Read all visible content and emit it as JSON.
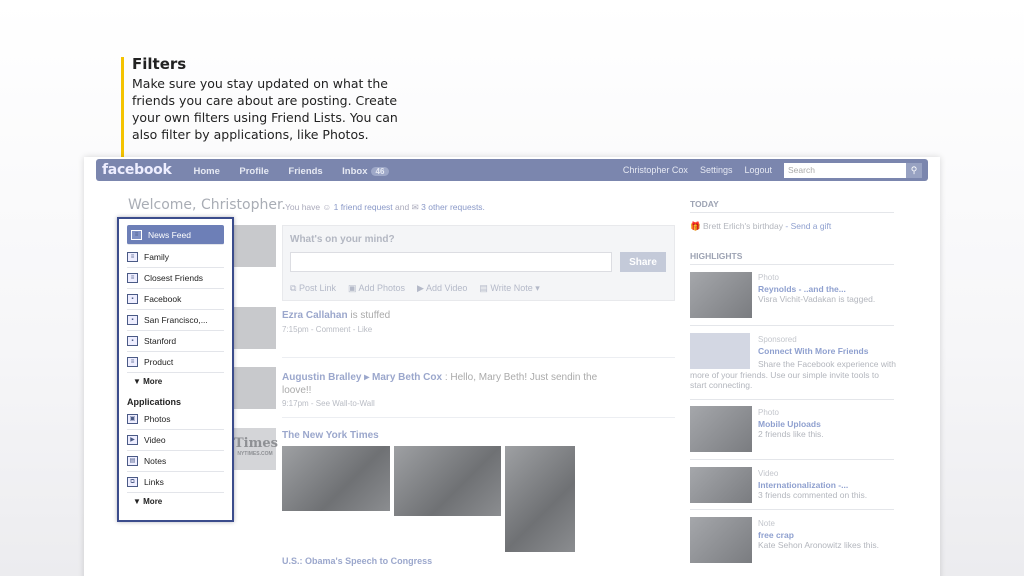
{
  "callout": {
    "title": "Filters",
    "text": "Make sure you stay updated on what the friends you care about are posting. Create your own filters using Friend Lists.  You can also filter by applications, like Photos."
  },
  "topbar": {
    "logo": "facebook",
    "nav": [
      "Home",
      "Profile",
      "Friends",
      "Inbox"
    ],
    "inbox_count": "46",
    "user": "Christopher Cox",
    "settings": "Settings",
    "logout": "Logout",
    "search_placeholder": "Search"
  },
  "welcome": "Welcome, Christopher.",
  "requests": {
    "prefix": "You have",
    "friend_count": "1",
    "friend_text": "friend request",
    "and": "and",
    "other_count": "3",
    "other_text": "other requests."
  },
  "status": {
    "prompt": "What's on your mind?",
    "share": "Share",
    "tools": [
      "Post Link",
      "Add Photos",
      "Add Video",
      "Write Note"
    ]
  },
  "stories": [
    {
      "name": "Ezra Callahan",
      "action": "is stuffed",
      "meta": "7:15pm - Comment - Like"
    },
    {
      "name": "Augustin Bralley ▸ Mary Beth Cox",
      "action": ": Hello, Mary Beth! Just sendin the",
      "action2": "loove!!",
      "meta": "9:17pm - See Wall-to-Wall"
    },
    {
      "name": "The New York Times",
      "action": "",
      "meta": ""
    }
  ],
  "times_logo": "Times",
  "times_sub": "NYTIMES.COM",
  "story_caption": "U.S.: Obama's Speech to Congress",
  "filters": {
    "items": [
      {
        "label": "News Feed",
        "active": true
      },
      {
        "label": "Family"
      },
      {
        "label": "Closest Friends"
      },
      {
        "label": "Facebook"
      },
      {
        "label": "San Francisco,..."
      },
      {
        "label": "Stanford"
      },
      {
        "label": "Product"
      }
    ],
    "more": "▼ More",
    "apps_heading": "Applications",
    "apps": [
      {
        "label": "Photos"
      },
      {
        "label": "Video"
      },
      {
        "label": "Notes"
      },
      {
        "label": "Links"
      }
    ],
    "more2": "▼ More"
  },
  "right": {
    "today_heading": "TODAY",
    "birthday": "Brett Erlich's birthday",
    "send_gift": "- Send a gift",
    "highlights_heading": "HIGHLIGHTS",
    "highlights": [
      {
        "kind": "Photo",
        "title": "Reynolds - ..and the...",
        "desc": "Visra Vichit-Vadakan is tagged."
      },
      {
        "kind": "Sponsored",
        "title": "Connect With More Friends",
        "desc": "Share the Facebook experience with more of your friends. Use our simple invite tools to start connecting."
      },
      {
        "kind": "Photo",
        "title": "Mobile Uploads",
        "desc": "2 friends like this."
      },
      {
        "kind": "Video",
        "title": "Internationalization -...",
        "desc": "3 friends commented on this."
      },
      {
        "kind": "Note",
        "title": "free crap",
        "desc": "Kate Sehon Aronowitz likes this."
      }
    ]
  }
}
